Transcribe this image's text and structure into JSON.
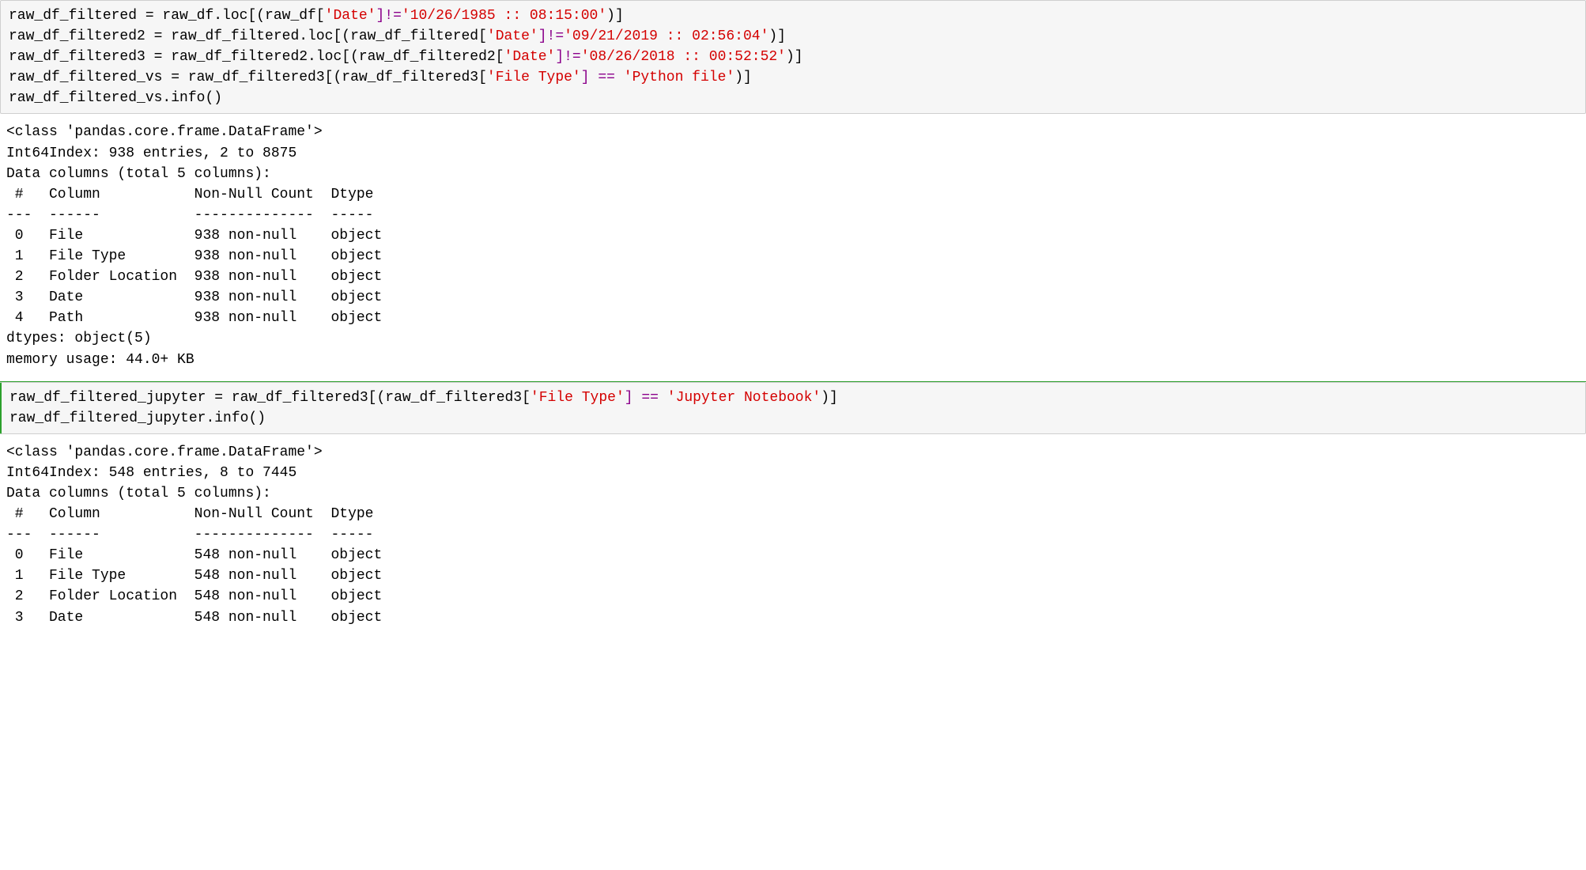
{
  "cell1": {
    "line1": {
      "pre": "raw_df_filtered = raw_df.loc[(raw_df[",
      "col": "'Date'",
      "op": "]!=",
      "val": "'10/26/1985 :: 08:15:00'",
      "post": ")]"
    },
    "line2": {
      "pre": "raw_df_filtered2 = raw_df_filtered.loc[(raw_df_filtered[",
      "col": "'Date'",
      "op": "]!=",
      "val": "'09/21/2019 :: 02:56:04'",
      "post": ")]"
    },
    "line3": {
      "pre": "raw_df_filtered3 = raw_df_filtered2.loc[(raw_df_filtered2[",
      "col": "'Date'",
      "op": "]!=",
      "val": "'08/26/2018 :: 00:52:52'",
      "post": ")]"
    },
    "line4": {
      "pre": "raw_df_filtered_vs = raw_df_filtered3[(raw_df_filtered3[",
      "col": "'File Type'",
      "op": "] ==",
      "space": " ",
      "val": "'Python file'",
      "post": ")]"
    },
    "line5": "raw_df_filtered_vs.info()"
  },
  "out1": {
    "l1": "<class 'pandas.core.frame.DataFrame'>",
    "l2": "Int64Index: 938 entries, 2 to 8875",
    "l3": "Data columns (total 5 columns):",
    "l4": " #   Column           Non-Null Count  Dtype ",
    "l5": "---  ------           --------------  ----- ",
    "l6": " 0   File             938 non-null    object",
    "l7": " 1   File Type        938 non-null    object",
    "l8": " 2   Folder Location  938 non-null    object",
    "l9": " 3   Date             938 non-null    object",
    "l10": " 4   Path             938 non-null    object",
    "l11": "dtypes: object(5)",
    "l12": "memory usage: 44.0+ KB"
  },
  "cell2": {
    "line1": {
      "pre": "raw_df_filtered_jupyter = raw_df_filtered3[(raw_df_filtered3[",
      "col": "'File Type'",
      "op": "] ==",
      "space": " ",
      "val": "'Jupyter Notebook'",
      "post": ")]"
    },
    "line2": "raw_df_filtered_jupyter.info()"
  },
  "out2": {
    "l1": "<class 'pandas.core.frame.DataFrame'>",
    "l2": "Int64Index: 548 entries, 8 to 7445",
    "l3": "Data columns (total 5 columns):",
    "l4": " #   Column           Non-Null Count  Dtype ",
    "l5": "---  ------           --------------  ----- ",
    "l6": " 0   File             548 non-null    object",
    "l7": " 1   File Type        548 non-null    object",
    "l8": " 2   Folder Location  548 non-null    object",
    "l9": " 3   Date             548 non-null    object"
  }
}
